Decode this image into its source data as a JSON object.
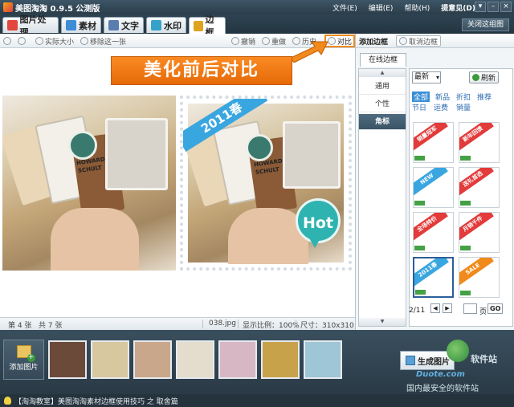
{
  "window": {
    "title": "美图淘淘 0.9.5 公测版",
    "menus": [
      "文件(E)",
      "编辑(E)",
      "帮助(H)",
      "提意见(D)"
    ],
    "controls": [
      "▾",
      "–",
      "×"
    ]
  },
  "tabs": [
    {
      "label": "图片处理",
      "color": "#e2473b"
    },
    {
      "label": "素材",
      "color": "#3c8cd6"
    },
    {
      "label": "文字",
      "color": "#5a7db0"
    },
    {
      "label": "水印",
      "color": "#35a2c9"
    },
    {
      "label": "边框",
      "color": "#e0a320",
      "active": true
    }
  ],
  "close_album_label": "关闭这组图",
  "toolbar": {
    "actual_size": "实际大小",
    "remove_one": "移除这一张",
    "undo": "撤销",
    "redo": "重做",
    "history": "历史",
    "compare": "对比"
  },
  "callout_text": "美化前后对比",
  "photo": {
    "ribbon_text": "2011春",
    "hot_text": "Hot",
    "card_text_1": "HOWARD",
    "card_text_2": "SCHULT"
  },
  "status": {
    "page": "第 4 张",
    "total": "共 7 张",
    "file": "038.jpg",
    "scale": "显示比例：100%",
    "size": "尺寸：310x310"
  },
  "right_panel": {
    "header": "添加边框",
    "cancel_border": "取消边框",
    "online_tab": "在线边框",
    "categories": [
      {
        "label": "通用",
        "active": false
      },
      {
        "label": "个性",
        "active": false
      },
      {
        "label": "角标",
        "active": true
      }
    ],
    "sort": "最新",
    "refresh": "刷新",
    "filters_row1": [
      {
        "label": "全部",
        "active": true
      },
      {
        "label": "新品",
        "active": false
      },
      {
        "label": "折扣",
        "active": false
      },
      {
        "label": "推荐",
        "active": false
      }
    ],
    "filters_row2": [
      "节日",
      "运费",
      "销量"
    ],
    "thumbnails": [
      {
        "text": "销量冠军",
        "color": "#e33a3a",
        "selected": false
      },
      {
        "text": "新年回馈",
        "color": "#e33a3a",
        "selected": false
      },
      {
        "text": "NEW",
        "color": "#3aa6e0",
        "selected": false
      },
      {
        "text": "送礼首选",
        "color": "#e33a3a",
        "selected": false
      },
      {
        "text": "全场特价",
        "color": "#e33a3a",
        "selected": false
      },
      {
        "text": "月销千件",
        "color": "#e33a3a",
        "selected": false
      },
      {
        "text": "2011春",
        "color": "#3aa6e0",
        "selected": true
      },
      {
        "text": "SALE",
        "color": "#f08a1c",
        "selected": false
      }
    ],
    "pager": {
      "current": "2/11",
      "prev": "◀",
      "next": "▶",
      "page_unit": "页",
      "go": "GO"
    }
  },
  "filmstrip": {
    "add_photo": "添加图片",
    "thumbs": [
      {
        "color": "#6b4a3a",
        "selected": false
      },
      {
        "color": "#d8c8a0",
        "selected": false
      },
      {
        "color": "#c9a78a",
        "selected": false
      },
      {
        "color": "#b35a4a",
        "selected": false
      },
      {
        "color": "#e4dccd",
        "selected": true
      },
      {
        "color": "#d7b7c3",
        "selected": false
      },
      {
        "color": "#c8a24a",
        "selected": false
      },
      {
        "color": "#9ec6d6",
        "selected": false
      }
    ],
    "generate": "生成图片"
  },
  "watermark": {
    "site": "软件站",
    "url": "Duote.com",
    "slogan": "国内最安全的软件站"
  },
  "tip": "【淘淘教室】美图淘淘素材边框使用技巧 之 取舍篇"
}
